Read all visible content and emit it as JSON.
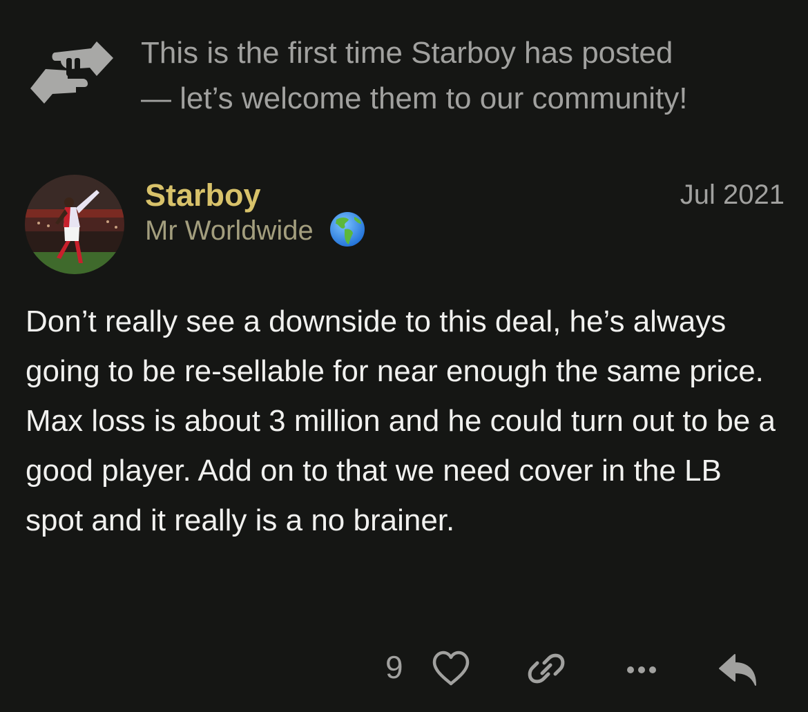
{
  "notice": {
    "icon": "handshake-icon",
    "text_line1": "This is the first time Starboy has posted",
    "text_line2": "— let’s welcome them to our community!"
  },
  "post": {
    "avatar": "user-avatar-photo",
    "username": "Starboy",
    "user_title": "Mr Worldwide",
    "user_title_emoji": "globe-americas-emoji",
    "date": "Jul 2021",
    "body": "Don’t really see a downside to this deal, he’s always going to be re-sellable for near enough the same price. Max loss is about 3 million and he could turn out to be a good player. Add on to that we need cover in the LB spot and it really is a no brainer."
  },
  "actions": {
    "like_count": "9",
    "icons": [
      "heart-icon",
      "link-icon",
      "more-icon",
      "reply-icon"
    ]
  },
  "colors": {
    "background": "#151614",
    "username": "#d8c26a",
    "user_title": "#a39e7e",
    "muted": "#a1a19f",
    "body_text": "#f1f1ef"
  }
}
